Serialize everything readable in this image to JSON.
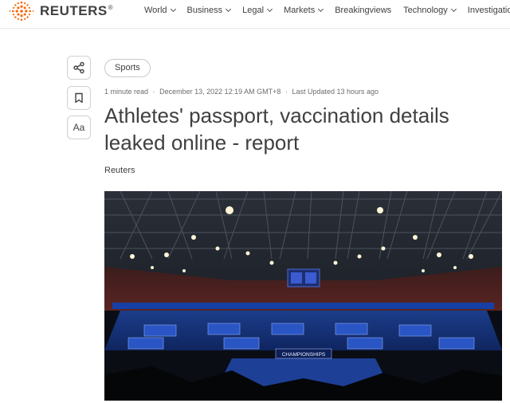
{
  "header": {
    "logo_text": "REUTERS",
    "logo_reg": "®",
    "logo_icon": "reuters-dot-sunburst",
    "nav": [
      {
        "label": "World",
        "has_dropdown": true
      },
      {
        "label": "Business",
        "has_dropdown": true
      },
      {
        "label": "Legal",
        "has_dropdown": true
      },
      {
        "label": "Markets",
        "has_dropdown": true
      },
      {
        "label": "Breakingviews",
        "has_dropdown": false
      },
      {
        "label": "Technology",
        "has_dropdown": true
      },
      {
        "label": "Investigation",
        "has_dropdown": false
      }
    ]
  },
  "rail": {
    "share_icon": "share-icon",
    "bookmark_icon": "bookmark-icon",
    "text_size_label": "Aa"
  },
  "article": {
    "tag": "Sports",
    "meta": {
      "read_time": "1 minute read",
      "published": "December 13, 2022 12:19 AM GMT+8",
      "updated": "Last Updated 13 hours ago",
      "separator": "·"
    },
    "headline": "Athletes' passport, vaccination details leaked online - report",
    "author": "Reuters",
    "photo": {
      "scoreboard_text": "CHAMPIONSHIPS",
      "accent": "#1b3a8c"
    }
  },
  "colors": {
    "logo_orange": "#fa6400",
    "text": "#404040",
    "muted": "#6d6d6d",
    "border": "#d0d0d0"
  }
}
